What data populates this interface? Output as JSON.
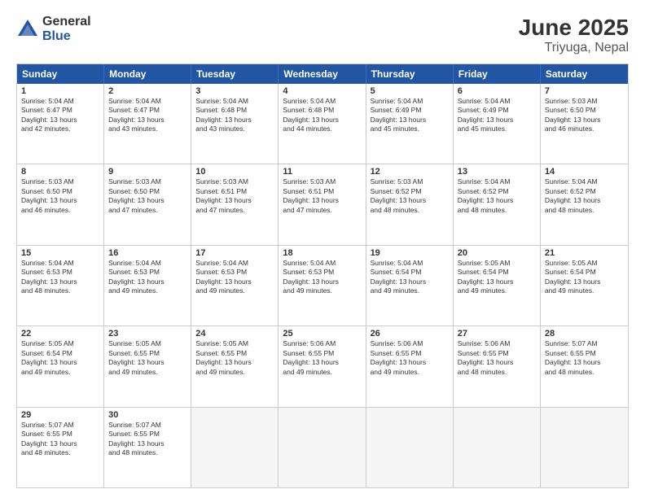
{
  "logo": {
    "general": "General",
    "blue": "Blue"
  },
  "title": "June 2025",
  "subtitle": "Triyuga, Nepal",
  "headers": [
    "Sunday",
    "Monday",
    "Tuesday",
    "Wednesday",
    "Thursday",
    "Friday",
    "Saturday"
  ],
  "rows": [
    [
      {
        "day": "1",
        "lines": [
          "Sunrise: 5:04 AM",
          "Sunset: 6:47 PM",
          "Daylight: 13 hours",
          "and 42 minutes."
        ]
      },
      {
        "day": "2",
        "lines": [
          "Sunrise: 5:04 AM",
          "Sunset: 6:47 PM",
          "Daylight: 13 hours",
          "and 43 minutes."
        ]
      },
      {
        "day": "3",
        "lines": [
          "Sunrise: 5:04 AM",
          "Sunset: 6:48 PM",
          "Daylight: 13 hours",
          "and 43 minutes."
        ]
      },
      {
        "day": "4",
        "lines": [
          "Sunrise: 5:04 AM",
          "Sunset: 6:48 PM",
          "Daylight: 13 hours",
          "and 44 minutes."
        ]
      },
      {
        "day": "5",
        "lines": [
          "Sunrise: 5:04 AM",
          "Sunset: 6:49 PM",
          "Daylight: 13 hours",
          "and 45 minutes."
        ]
      },
      {
        "day": "6",
        "lines": [
          "Sunrise: 5:04 AM",
          "Sunset: 6:49 PM",
          "Daylight: 13 hours",
          "and 45 minutes."
        ]
      },
      {
        "day": "7",
        "lines": [
          "Sunrise: 5:03 AM",
          "Sunset: 6:50 PM",
          "Daylight: 13 hours",
          "and 46 minutes."
        ]
      }
    ],
    [
      {
        "day": "8",
        "lines": [
          "Sunrise: 5:03 AM",
          "Sunset: 6:50 PM",
          "Daylight: 13 hours",
          "and 46 minutes."
        ]
      },
      {
        "day": "9",
        "lines": [
          "Sunrise: 5:03 AM",
          "Sunset: 6:50 PM",
          "Daylight: 13 hours",
          "and 47 minutes."
        ]
      },
      {
        "day": "10",
        "lines": [
          "Sunrise: 5:03 AM",
          "Sunset: 6:51 PM",
          "Daylight: 13 hours",
          "and 47 minutes."
        ]
      },
      {
        "day": "11",
        "lines": [
          "Sunrise: 5:03 AM",
          "Sunset: 6:51 PM",
          "Daylight: 13 hours",
          "and 47 minutes."
        ]
      },
      {
        "day": "12",
        "lines": [
          "Sunrise: 5:03 AM",
          "Sunset: 6:52 PM",
          "Daylight: 13 hours",
          "and 48 minutes."
        ]
      },
      {
        "day": "13",
        "lines": [
          "Sunrise: 5:04 AM",
          "Sunset: 6:52 PM",
          "Daylight: 13 hours",
          "and 48 minutes."
        ]
      },
      {
        "day": "14",
        "lines": [
          "Sunrise: 5:04 AM",
          "Sunset: 6:52 PM",
          "Daylight: 13 hours",
          "and 48 minutes."
        ]
      }
    ],
    [
      {
        "day": "15",
        "lines": [
          "Sunrise: 5:04 AM",
          "Sunset: 6:53 PM",
          "Daylight: 13 hours",
          "and 48 minutes."
        ]
      },
      {
        "day": "16",
        "lines": [
          "Sunrise: 5:04 AM",
          "Sunset: 6:53 PM",
          "Daylight: 13 hours",
          "and 49 minutes."
        ]
      },
      {
        "day": "17",
        "lines": [
          "Sunrise: 5:04 AM",
          "Sunset: 6:53 PM",
          "Daylight: 13 hours",
          "and 49 minutes."
        ]
      },
      {
        "day": "18",
        "lines": [
          "Sunrise: 5:04 AM",
          "Sunset: 6:53 PM",
          "Daylight: 13 hours",
          "and 49 minutes."
        ]
      },
      {
        "day": "19",
        "lines": [
          "Sunrise: 5:04 AM",
          "Sunset: 6:54 PM",
          "Daylight: 13 hours",
          "and 49 minutes."
        ]
      },
      {
        "day": "20",
        "lines": [
          "Sunrise: 5:05 AM",
          "Sunset: 6:54 PM",
          "Daylight: 13 hours",
          "and 49 minutes."
        ]
      },
      {
        "day": "21",
        "lines": [
          "Sunrise: 5:05 AM",
          "Sunset: 6:54 PM",
          "Daylight: 13 hours",
          "and 49 minutes."
        ]
      }
    ],
    [
      {
        "day": "22",
        "lines": [
          "Sunrise: 5:05 AM",
          "Sunset: 6:54 PM",
          "Daylight: 13 hours",
          "and 49 minutes."
        ]
      },
      {
        "day": "23",
        "lines": [
          "Sunrise: 5:05 AM",
          "Sunset: 6:55 PM",
          "Daylight: 13 hours",
          "and 49 minutes."
        ]
      },
      {
        "day": "24",
        "lines": [
          "Sunrise: 5:05 AM",
          "Sunset: 6:55 PM",
          "Daylight: 13 hours",
          "and 49 minutes."
        ]
      },
      {
        "day": "25",
        "lines": [
          "Sunrise: 5:06 AM",
          "Sunset: 6:55 PM",
          "Daylight: 13 hours",
          "and 49 minutes."
        ]
      },
      {
        "day": "26",
        "lines": [
          "Sunrise: 5:06 AM",
          "Sunset: 6:55 PM",
          "Daylight: 13 hours",
          "and 49 minutes."
        ]
      },
      {
        "day": "27",
        "lines": [
          "Sunrise: 5:06 AM",
          "Sunset: 6:55 PM",
          "Daylight: 13 hours",
          "and 48 minutes."
        ]
      },
      {
        "day": "28",
        "lines": [
          "Sunrise: 5:07 AM",
          "Sunset: 6:55 PM",
          "Daylight: 13 hours",
          "and 48 minutes."
        ]
      }
    ],
    [
      {
        "day": "29",
        "lines": [
          "Sunrise: 5:07 AM",
          "Sunset: 6:55 PM",
          "Daylight: 13 hours",
          "and 48 minutes."
        ]
      },
      {
        "day": "30",
        "lines": [
          "Sunrise: 5:07 AM",
          "Sunset: 6:55 PM",
          "Daylight: 13 hours",
          "and 48 minutes."
        ]
      },
      {
        "day": "",
        "lines": [],
        "empty": true
      },
      {
        "day": "",
        "lines": [],
        "empty": true
      },
      {
        "day": "",
        "lines": [],
        "empty": true
      },
      {
        "day": "",
        "lines": [],
        "empty": true
      },
      {
        "day": "",
        "lines": [],
        "empty": true
      }
    ]
  ]
}
